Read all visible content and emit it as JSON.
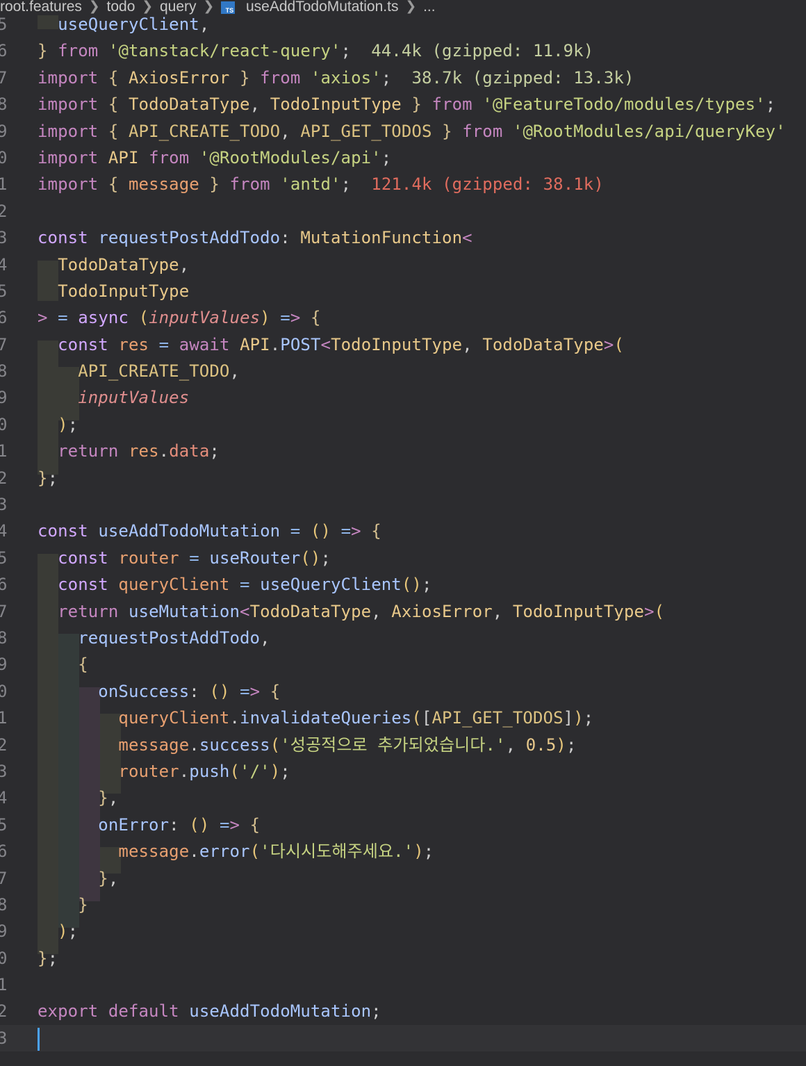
{
  "breadcrumb": {
    "items": [
      "root.features",
      "todo",
      "query"
    ],
    "file_icon": "TS",
    "file_name": "useAddTodoMutation.ts",
    "trailing": "..."
  },
  "editor": {
    "lines": [
      {
        "n": "5",
        "text": "  useQueryClient,"
      },
      {
        "n": "6",
        "text": "} from '@tanstack/react-query';  44.4k (gzipped: 11.9k)"
      },
      {
        "n": "7",
        "text": "import { AxiosError } from 'axios';  38.7k (gzipped: 13.3k)"
      },
      {
        "n": "8",
        "text": "import { TodoDataType, TodoInputType } from '@FeatureTodo/modules/types';"
      },
      {
        "n": "9",
        "text": "import { API_CREATE_TODO, API_GET_TODOS } from '@RootModules/api/queryKey'"
      },
      {
        "n": "0",
        "text": "import API from '@RootModules/api';"
      },
      {
        "n": "1",
        "text": "import { message } from 'antd';  121.4k (gzipped: 38.1k)"
      },
      {
        "n": "2",
        "text": ""
      },
      {
        "n": "3",
        "text": "const requestPostAddTodo: MutationFunction<"
      },
      {
        "n": "4",
        "text": "  TodoDataType,"
      },
      {
        "n": "5",
        "text": "  TodoInputType"
      },
      {
        "n": "6",
        "text": "> = async (inputValues) => {"
      },
      {
        "n": "7",
        "text": "  const res = await API.POST<TodoInputType, TodoDataType>("
      },
      {
        "n": "8",
        "text": "    API_CREATE_TODO,"
      },
      {
        "n": "9",
        "text": "    inputValues"
      },
      {
        "n": "0",
        "text": "  );"
      },
      {
        "n": "1",
        "text": "  return res.data;"
      },
      {
        "n": "2",
        "text": "};"
      },
      {
        "n": "3",
        "text": ""
      },
      {
        "n": "4",
        "text": "const useAddTodoMutation = () => {"
      },
      {
        "n": "5",
        "text": "  const router = useRouter();"
      },
      {
        "n": "6",
        "text": "  const queryClient = useQueryClient();"
      },
      {
        "n": "7",
        "text": "  return useMutation<TodoDataType, AxiosError, TodoInputType>("
      },
      {
        "n": "8",
        "text": "    requestPostAddTodo,"
      },
      {
        "n": "9",
        "text": "    {"
      },
      {
        "n": "0",
        "text": "      onSuccess: () => {"
      },
      {
        "n": "1",
        "text": "        queryClient.invalidateQueries([API_GET_TODOS]);"
      },
      {
        "n": "2",
        "text": "        message.success('성공적으로 추가되었습니다.', 0.5);"
      },
      {
        "n": "3",
        "text": "        router.push('/');"
      },
      {
        "n": "4",
        "text": "      },"
      },
      {
        "n": "5",
        "text": "      onError: () => {"
      },
      {
        "n": "6",
        "text": "        message.error('다시시도해주세요.');"
      },
      {
        "n": "7",
        "text": "      },"
      },
      {
        "n": "8",
        "text": "    }"
      },
      {
        "n": "9",
        "text": "  );"
      },
      {
        "n": "0",
        "text": "};"
      },
      {
        "n": "1",
        "text": ""
      },
      {
        "n": "2",
        "text": "export default useAddTodoMutation;"
      },
      {
        "n": "3",
        "text": ""
      }
    ],
    "current_line_index": 38
  },
  "colors": {
    "background": "#2c2c2f",
    "keyword": "#c586c0",
    "string": "#c6d382",
    "function": "#8fb4e8",
    "type": "#e9c98a",
    "import_size_red": "#e06c5e",
    "cursor": "#4aa3ff"
  }
}
